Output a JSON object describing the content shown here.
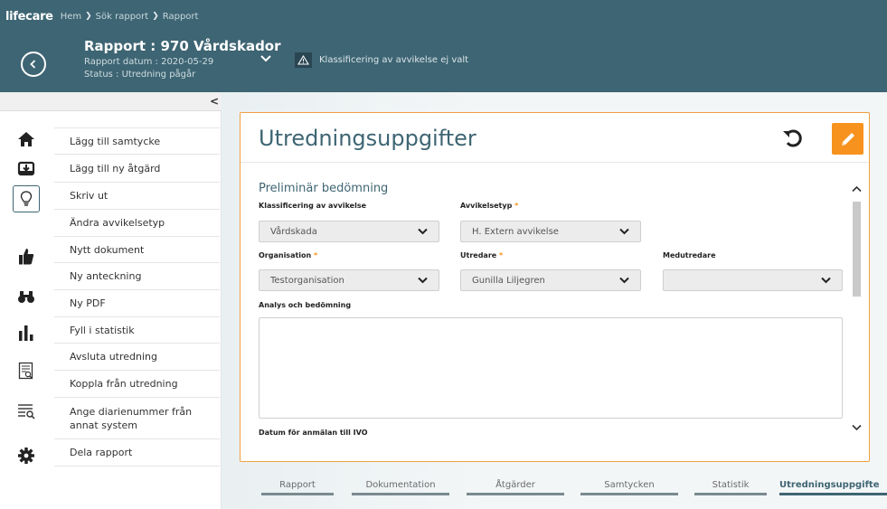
{
  "app": {
    "brand": "lifecare"
  },
  "breadcrumb": [
    "Hem",
    "Sök rapport",
    "Rapport"
  ],
  "report": {
    "title": "Rapport : 970 Vårdskador",
    "date": "Rapport datum : 2020-05-29",
    "status": "Status : Utredning pågår",
    "warning": "Klassificering av avvikelse ej valt"
  },
  "rail_icons": [
    "home-icon",
    "inbox-icon",
    "lightbulb-icon",
    "thumbs-up-icon",
    "binoculars-icon",
    "bar-chart-icon",
    "report-search-icon",
    "list-search-icon",
    "gear-icon"
  ],
  "menu": [
    "Lägg till samtycke",
    "Lägg till ny åtgärd",
    "Skriv ut",
    "Ändra avvikelsetyp",
    "Nytt dokument",
    "Ny anteckning",
    "Ny PDF",
    "Fyll i statistik",
    "Avsluta utredning",
    "Koppla från utredning",
    "Ange diarienummer från annat system",
    "Dela rapport"
  ],
  "card": {
    "title": "Utredningsuppgifter",
    "section": "Preliminär bedömning",
    "fields": {
      "classification": {
        "label": "Klassificering av avvikelse",
        "value": "Vårdskada"
      },
      "type": {
        "label": "Avvikelsetyp",
        "required_mark": "*",
        "value": "H. Extern avvikelse"
      },
      "organisation": {
        "label": "Organisation",
        "required_mark": "*",
        "value": "Testorganisation"
      },
      "investigator": {
        "label": "Utredare",
        "required_mark": "*",
        "value": "Gunilla Liljegren"
      },
      "co_investigator": {
        "label": "Medutredare",
        "value": ""
      },
      "analysis": {
        "label": "Analys och bedömning",
        "value": ""
      },
      "ivo_date": {
        "label": "Datum för anmälan till IVO"
      }
    }
  },
  "tabs": [
    "Rapport",
    "Dokumentation",
    "Åtgärder",
    "Samtycken",
    "Statistik",
    "Utredningsuppgifte"
  ],
  "colors": {
    "header": "#3e6573",
    "accent": "#f7921e",
    "title": "#3e6573"
  }
}
